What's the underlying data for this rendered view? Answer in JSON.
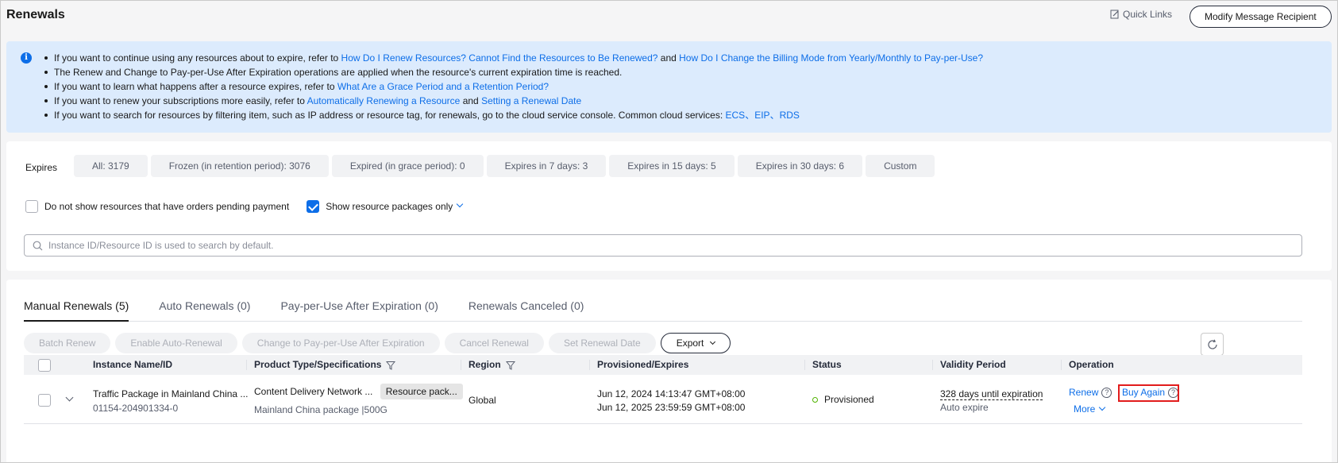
{
  "header": {
    "title": "Renewals",
    "quick_links": "Quick Links",
    "modify_button": "Modify Message Recipient"
  },
  "banner": {
    "line1": {
      "pre": "If you want to continue using any resources about to expire, refer to ",
      "link1": "How Do I Renew Resources? Cannot Find the Resources to Be Renewed?",
      "mid": " and ",
      "link2": "How Do I Change the Billing Mode from Yearly/Monthly to Pay-per-Use?"
    },
    "line2": "The Renew and Change to Pay-per-Use After Expiration operations are applied when the resource's current expiration time is reached.",
    "line3": {
      "pre": "If you want to learn what happens after a resource expires, refer to ",
      "link": "What Are a Grace Period and a Retention Period?"
    },
    "line4": {
      "pre": "If you want to renew your subscriptions more easily, refer to ",
      "link1": "Automatically Renewing a Resource",
      "mid": " and ",
      "link2": "Setting a Renewal Date"
    },
    "line5": {
      "pre": "If you want to search for resources by filtering item, such as IP address or resource tag, for renewals, go to the cloud service console. Common cloud services: ",
      "ecs": "ECS",
      "sep1": "、",
      "eip": "EIP",
      "sep2": "、",
      "rds": "RDS"
    }
  },
  "filters": {
    "expires_label": "Expires",
    "chips": [
      "All: 3179",
      "Frozen (in retention period): 3076",
      "Expired (in grace period): 0",
      "Expires in 7 days: 3",
      "Expires in 15 days: 5",
      "Expires in 30 days: 6",
      "Custom"
    ],
    "hide_pending_label": "Do not show resources that have orders pending payment",
    "show_packages_label": "Show resource packages only",
    "search_placeholder": "Instance ID/Resource ID is used to search by default."
  },
  "tabs": [
    "Manual Renewals (5)",
    "Auto Renewals (0)",
    "Pay-per-Use After Expiration (0)",
    "Renewals Canceled (0)"
  ],
  "toolbar": {
    "batch_renew": "Batch Renew",
    "enable_auto": "Enable Auto-Renewal",
    "change_ppu": "Change to Pay-per-Use After Expiration",
    "cancel_renewal": "Cancel Renewal",
    "set_date": "Set Renewal Date",
    "export": "Export"
  },
  "table": {
    "columns": [
      "Instance Name/ID",
      "Product Type/Specifications",
      "Region",
      "Provisioned/Expires",
      "Status",
      "Validity Period",
      "Operation"
    ],
    "row": {
      "name": "Traffic Package in Mainland China ...",
      "id": "01154-204901334-0",
      "product": "Content Delivery Network ...",
      "tag": "Resource pack...",
      "spec": "Mainland China package |500G",
      "region": "Global",
      "provisioned": "Jun 12, 2024 14:13:47 GMT+08:00",
      "expires": "Jun 12, 2025 23:59:59 GMT+08:00",
      "status": "Provisioned",
      "validity": "328 days until expiration",
      "validity_sub": "Auto expire",
      "op_renew": "Renew",
      "op_buy": "Buy Again",
      "op_more": "More"
    }
  },
  "colors": {
    "accent": "#0d6ee8",
    "success": "#50b300",
    "highlight": "#e21c1c"
  }
}
